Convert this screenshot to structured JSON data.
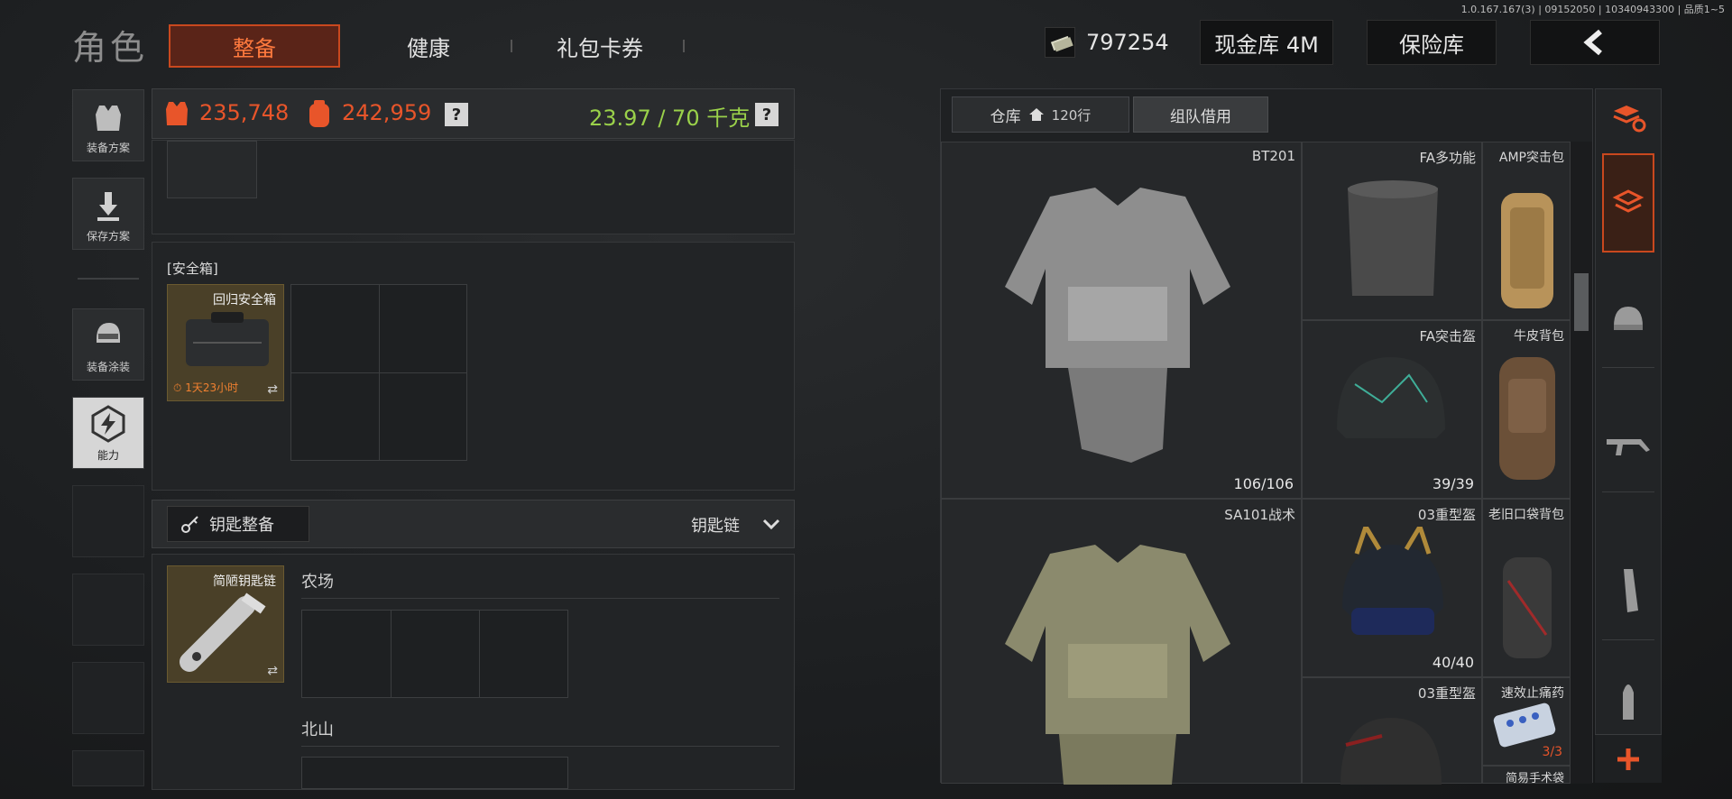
{
  "version_text": "1.0.167.167(3) | 09152050 | 10340943300 | 品质1~5",
  "page_title": "角色",
  "tabs": [
    {
      "label": "整备",
      "active": true
    },
    {
      "label": "健康",
      "active": false
    },
    {
      "label": "礼包卡券",
      "active": false
    }
  ],
  "currency": {
    "value": "797254",
    "icon": "cash-icon"
  },
  "cash_vault": "现金库 4M",
  "insurance_vault": "保险库",
  "sidebar": [
    {
      "label": "装备方案",
      "icon": "vest-icon"
    },
    {
      "label": "保存方案",
      "icon": "download-icon"
    },
    {
      "label": "装备涂装",
      "icon": "helmet-paint-icon"
    },
    {
      "label": "能力",
      "icon": "ability-icon",
      "selected": true
    }
  ],
  "loadout_header": {
    "vest_value": "235,748",
    "bag_value": "242,959",
    "weight": "23.97 / 70 千克",
    "help": "?"
  },
  "safe_box": {
    "title": "[安全箱]",
    "item_name": "回归安全箱",
    "timer": "1天23小时"
  },
  "key_section": {
    "button_label": "钥匙整备",
    "dropdown_label": "钥匙链",
    "item_name": "简陋钥匙链",
    "maps": [
      "农场",
      "北山"
    ]
  },
  "warehouse": {
    "tab_label": "仓库",
    "rows": "120行",
    "team_tab": "组队借用",
    "items": [
      {
        "name": "BT201",
        "count": "106/106"
      },
      {
        "name": "FA多功能",
        "count": ""
      },
      {
        "name": "AMP突击包",
        "count": ""
      },
      {
        "name": "FA突击盔",
        "count": "39/39"
      },
      {
        "name": "牛皮背包",
        "count": ""
      },
      {
        "name": "SA101战术",
        "count": ""
      },
      {
        "name": "03重型盔",
        "count": "40/40"
      },
      {
        "name": "老旧口袋背包",
        "count": ""
      },
      {
        "name": "03重型盔",
        "count": ""
      },
      {
        "name": "速效止痛药",
        "count": "3/3"
      },
      {
        "name": "简易手术袋",
        "count": ""
      }
    ]
  },
  "category_bar": [
    {
      "icon": "stack-refresh-icon"
    },
    {
      "icon": "stack-swap-icon",
      "selected": true
    },
    {
      "icon": "helmet-icon"
    },
    {
      "icon": "rifle-icon"
    },
    {
      "icon": "magazine-icon"
    },
    {
      "icon": "bullet-icon"
    },
    {
      "icon": "plus-icon"
    }
  ],
  "colors": {
    "accent": "#e8552a",
    "weight_ok": "#9ad14a"
  }
}
